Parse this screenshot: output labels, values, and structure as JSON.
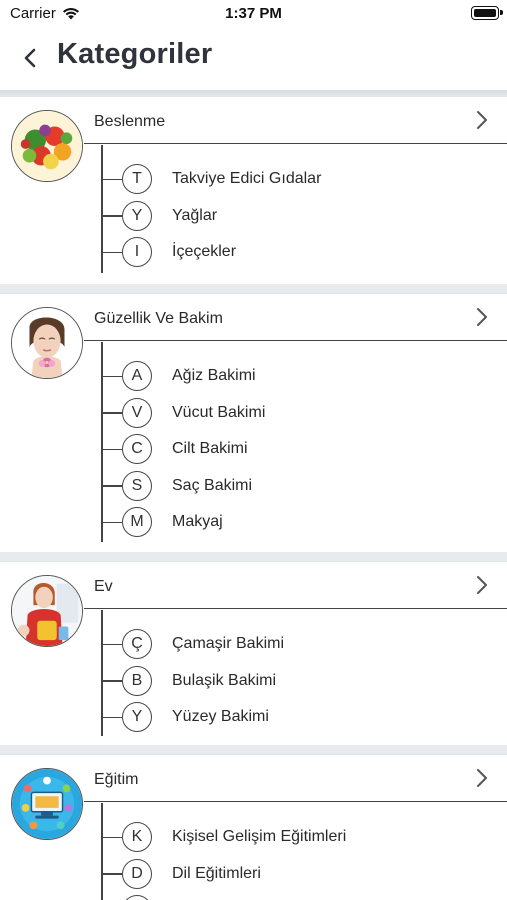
{
  "status_bar": {
    "carrier": "Carrier",
    "time": "1:37 PM"
  },
  "nav": {
    "title": "Kategoriler"
  },
  "categories": [
    {
      "title": "Beslenme",
      "image": "vegetables-image",
      "items": [
        {
          "letter": "T",
          "label": "Takviye Edici Gıdalar"
        },
        {
          "letter": "Y",
          "label": "Yağlar"
        },
        {
          "letter": "I",
          "label": "İçeçekler"
        }
      ]
    },
    {
      "title": "Güzellik Ve Bakim",
      "image": "beauty-face-image",
      "items": [
        {
          "letter": "A",
          "label": "Ağiz Bakimi"
        },
        {
          "letter": "V",
          "label": "Vücut Bakimi"
        },
        {
          "letter": "C",
          "label": "Cilt Bakimi"
        },
        {
          "letter": "S",
          "label": "Saç Bakimi"
        },
        {
          "letter": "M",
          "label": "Makyaj"
        }
      ]
    },
    {
      "title": "Ev",
      "image": "cleaning-woman-image",
      "items": [
        {
          "letter": "Ç",
          "label": "Çamaşir Bakimi"
        },
        {
          "letter": "B",
          "label": "Bulaşik Bakimi"
        },
        {
          "letter": "Y",
          "label": "Yüzey Bakimi"
        }
      ]
    },
    {
      "title": "Eğitim",
      "image": "education-computer-image",
      "items": [
        {
          "letter": "K",
          "label": "Kişisel Gelişim Eğitimleri"
        },
        {
          "letter": "D",
          "label": "Dil Eğitimleri"
        },
        {
          "letter": "",
          "label": ""
        }
      ]
    }
  ]
}
